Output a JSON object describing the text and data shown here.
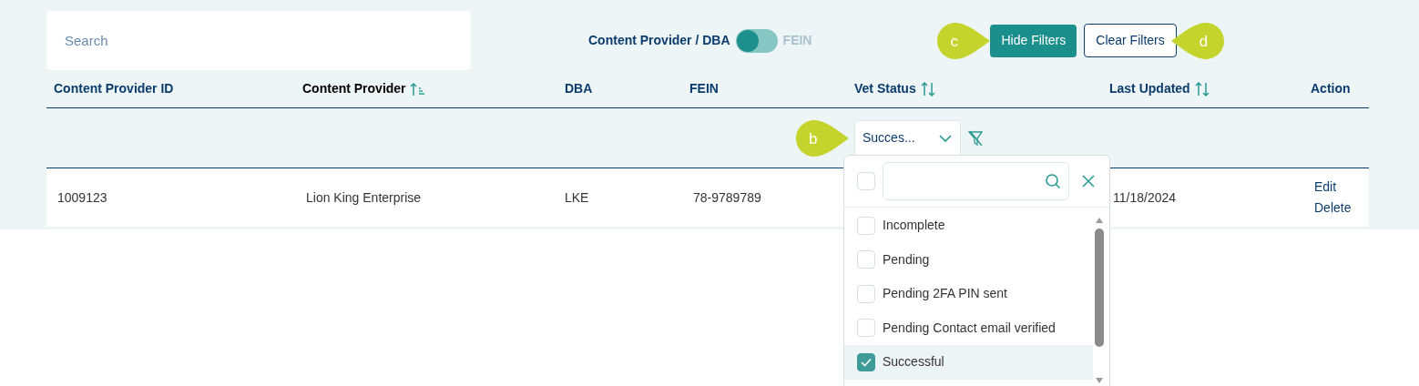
{
  "search": {
    "placeholder": "Search"
  },
  "toggle": {
    "left_label": "Content Provider / DBA",
    "right_label": "FEIN",
    "fein_selected": false
  },
  "buttons": [
    {
      "label": "Hide Filters",
      "kind": "primary",
      "callout": "c"
    },
    {
      "label": "Clear Filters",
      "kind": "outline",
      "callout": "d"
    }
  ],
  "table": {
    "columns": [
      {
        "label": "Content Provider ID",
        "sortable": false,
        "sorted_ascending": false
      },
      {
        "label": "Content Provider",
        "sortable": true,
        "sorted_ascending": true
      },
      {
        "label": "DBA",
        "sortable": false,
        "sorted_ascending": false
      },
      {
        "label": "FEIN",
        "sortable": false,
        "sorted_ascending": false
      },
      {
        "label": "Vet Status",
        "sortable": true,
        "sorted_ascending": false
      },
      {
        "label": "Last Updated",
        "sortable": true,
        "sorted_ascending": false
      },
      {
        "label": "Action",
        "sortable": false,
        "sorted_ascending": false
      }
    ],
    "filter": {
      "value": "Succes...",
      "callout": "b"
    },
    "rows": [
      {
        "cells": [
          "1009123",
          "Lion King Enterprise",
          "LKE",
          "78-9789789",
          "",
          "11/18/2024"
        ],
        "actions": [
          "Edit",
          "Delete"
        ]
      }
    ]
  },
  "dropdown": {
    "select_all_checked": false,
    "options": [
      {
        "label": "Incomplete",
        "checked": false
      },
      {
        "label": "Pending",
        "checked": false
      },
      {
        "label": "Pending 2FA PIN sent",
        "checked": false
      },
      {
        "label": "Pending Contact email verified",
        "checked": false
      },
      {
        "label": "Successful",
        "checked": true
      }
    ]
  }
}
